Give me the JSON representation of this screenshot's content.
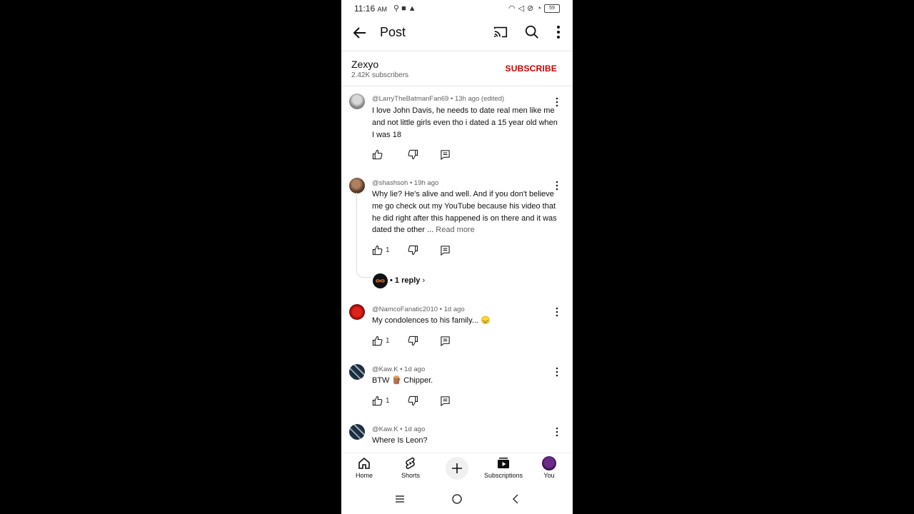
{
  "status_bar": {
    "time": "11:16",
    "ampm": "AM",
    "battery": "59"
  },
  "app_bar": {
    "title": "Post"
  },
  "channel": {
    "name": "Zexyo",
    "subscribers": "2.42K subscribers",
    "subscribe_label": "SUBSCRIBE"
  },
  "comments": [
    {
      "author": "@LarryTheBatmanFan69",
      "meta": " • 13h ago (edited)",
      "text": "I love John Davis, he needs to date real men like me and not little girls even tho i dated a 15 year old when I was 18",
      "likes": ""
    },
    {
      "author": "@shashsoh",
      "meta": " • 19h ago",
      "text": "Why lie? He's alive and well. And if you don't believe me go check out my YouTube because his video that he did right after this happened is on there and it was dated the other ... ",
      "read_more": "Read more",
      "likes": "1",
      "replies": "• 1 reply"
    },
    {
      "author": "@NamcoFanatic2010",
      "meta": " • 1d ago",
      "text": "My condolences to his family... 😞",
      "likes": "1"
    },
    {
      "author": "@Kaw.K",
      "meta": " • 1d ago",
      "text": "BTW 🪵 Chipper.",
      "likes": "1"
    },
    {
      "author": "@Kaw.K",
      "meta": " • 1d ago",
      "text": "Where Is Leon?"
    }
  ],
  "bottom_nav": {
    "home": "Home",
    "shorts": "Shorts",
    "subscriptions": "Subscriptions",
    "you": "You"
  },
  "colors": {
    "accent": "#cc0000",
    "text": "#0f0f0f",
    "secondary": "#606060"
  }
}
